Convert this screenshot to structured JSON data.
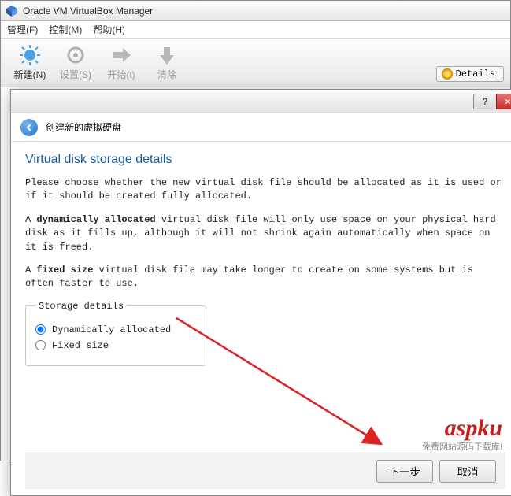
{
  "window": {
    "title": "Oracle VM VirtualBox Manager"
  },
  "menu": {
    "manage": "管理(F)",
    "control": "控制(M)",
    "help": "帮助(H)"
  },
  "toolbar": {
    "new": "新建(N)",
    "settings": "设置(S)",
    "start": "开始(t)",
    "discard": "清除",
    "details": "Details"
  },
  "dialog": {
    "back_header": "创建新的虚拟硬盘",
    "section_title": "Virtual disk storage details",
    "p1": "Please choose whether the new virtual disk file should be allocated as it is used or if it should be created fully allocated.",
    "p2a": "A ",
    "p2b": "dynamically allocated",
    "p2c": " virtual disk file will only use space on your physical hard disk as it fills up, although it will not shrink again automatically when space on it is freed.",
    "p3a": "A ",
    "p3b": "fixed size",
    "p3c": " virtual disk file may take longer to create on some systems but is often faster to use.",
    "fieldset_legend": "Storage details",
    "opt_dynamic": "Dynamically allocated",
    "opt_fixed": "Fixed size",
    "next": "下一步",
    "cancel": "取消",
    "help_btn": "?",
    "close_btn": "×"
  },
  "watermark": {
    "main": "aspku",
    "sub": "免费网站源码下载库!"
  }
}
